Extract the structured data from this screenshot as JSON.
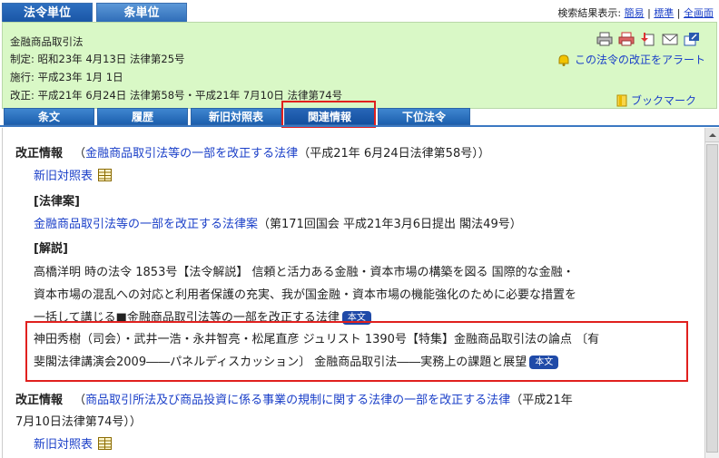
{
  "top_tabs": [
    {
      "label": "法令単位",
      "active": true
    },
    {
      "label": "条単位",
      "active": false
    }
  ],
  "display_mode": {
    "label": "検索結果表示:",
    "simple": "簡易",
    "sep": "|",
    "standard": "標準",
    "full": "全画面"
  },
  "law": {
    "name": "金融商品取引法",
    "enacted": "制定: 昭和23年 4月13日 法律第25号",
    "enforced": "施行: 平成23年 1月 1日",
    "amended": "改正: 平成21年 6月24日 法律第58号・平成21年 7月10日 法律第74号"
  },
  "alert_label": "この法令の改正をアラート",
  "bookmark_label": "ブックマーク",
  "sub_tabs": [
    "条文",
    "履歴",
    "新旧対照表",
    "関連情報",
    "下位法令"
  ],
  "colors": {
    "accent": "#1f4aa8",
    "highlight_border": "#e0201e",
    "panel_bg": "#d9f8c6",
    "link": "#1a3fc8"
  },
  "content": {
    "rev1": {
      "label": "改正情報",
      "open": "（",
      "link": "金融商品取引法等の一部を改正する法律",
      "close": "（平成21年 6月24日法律第58号））",
      "table_link": "新旧対照表"
    },
    "bill_header": "[法律案]",
    "bill_link": "金融商品取引法等の一部を改正する法律案",
    "bill_note": "（第171回国会 平成21年3月6日提出 閣法49号）",
    "commentary_header": "[解説]",
    "commentary1": [
      "高橋洋明 時の法令 1853号【法令解説】 信頼と活力ある金融・資本市場の構築を図る 国際的な金融・",
      "資本市場の混乱への対応と利用者保護の充実、我が国金融・資本市場の機能強化のために必要な措置を",
      "一括して講じる■金融商品取引法等の一部を改正する法律"
    ],
    "commentary2": [
      "神田秀樹（司会）・武井一浩・永井智亮・松尾直彦 ジュリスト 1390号【特集】金融商品取引法の論点 〔有",
      "斐閣法律講演会2009――パネルディスカッション〕 金融商品取引法――実務上の課題と展望"
    ],
    "badge": "本文",
    "rev2": {
      "label": "改正情報",
      "open": "（",
      "link": "商品取引所法及び商品投資に係る事業の規制に関する法律の一部を改正する法律",
      "close": "（平成21年",
      "line2": "7月10日法律第74号））",
      "table_link": "新旧対照表"
    }
  }
}
